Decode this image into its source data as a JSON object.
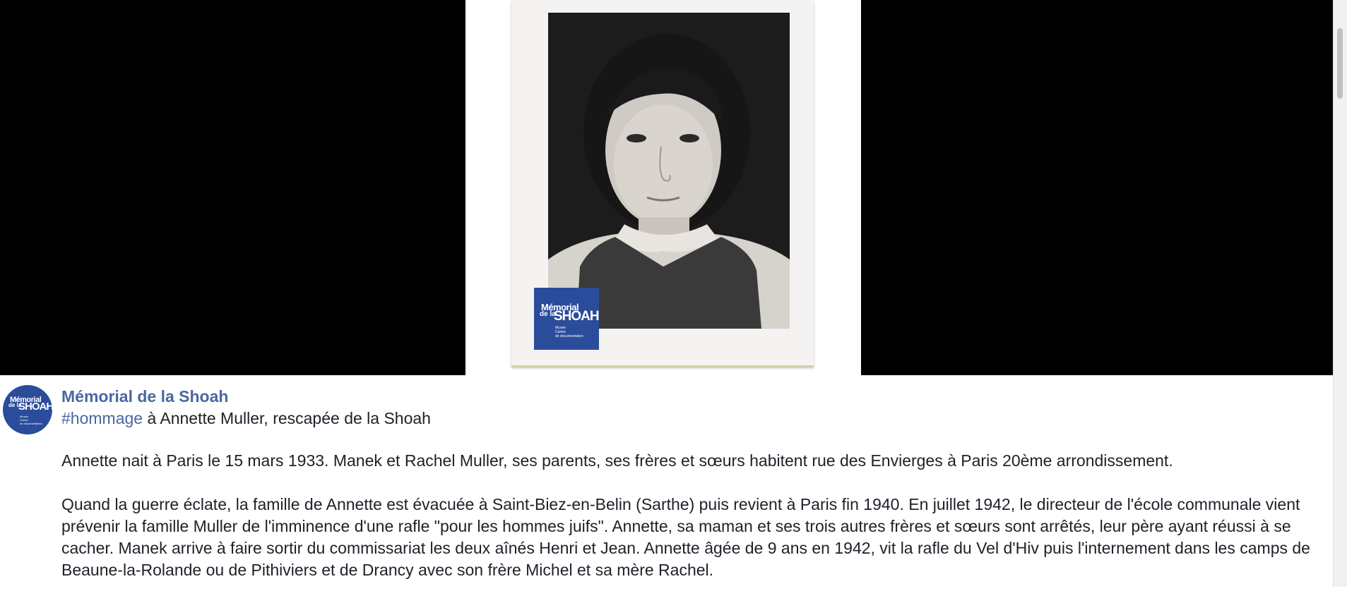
{
  "media": {
    "watermark": {
      "line1": "Mémorial",
      "line2": "de la",
      "line3": "SHOAH",
      "small": [
        "Musée",
        "Centre",
        "de documentation"
      ]
    }
  },
  "post": {
    "author": "Mémorial de la Shoah",
    "hashtag": "#hommage",
    "subtitle_rest": " à Annette Muller, rescapée de la Shoah",
    "paragraphs": [
      "Annette nait à Paris le 15 mars 1933. Manek et Rachel Muller, ses parents, ses frères et sœurs habitent rue des Envierges à Paris 20ème arrondissement.",
      "Quand la guerre éclate, la famille de Annette est évacuée à Saint-Biez-en-Belin (Sarthe) puis revient à Paris fin 1940. En juillet 1942, le directeur de l'école communale vient prévenir la famille Muller de l'imminence d'une rafle \"pour les hommes juifs\". Annette, sa maman et ses trois autres frères et sœurs sont arrêtés, leur père ayant réussi à se cacher. Manek arrive à faire sortir du commissariat les deux aînés Henri et Jean. Annette âgée de 9 ans en 1942, vit la rafle du Vel d'Hiv puis l'internement dans les camps de Beaune-la-Rolande ou de Pithiviers et de Drancy avec son frère Michel et sa mère Rachel."
    ]
  },
  "colors": {
    "link": "#4b67a1",
    "brand": "#2b4c9b",
    "text": "#1d2129"
  }
}
